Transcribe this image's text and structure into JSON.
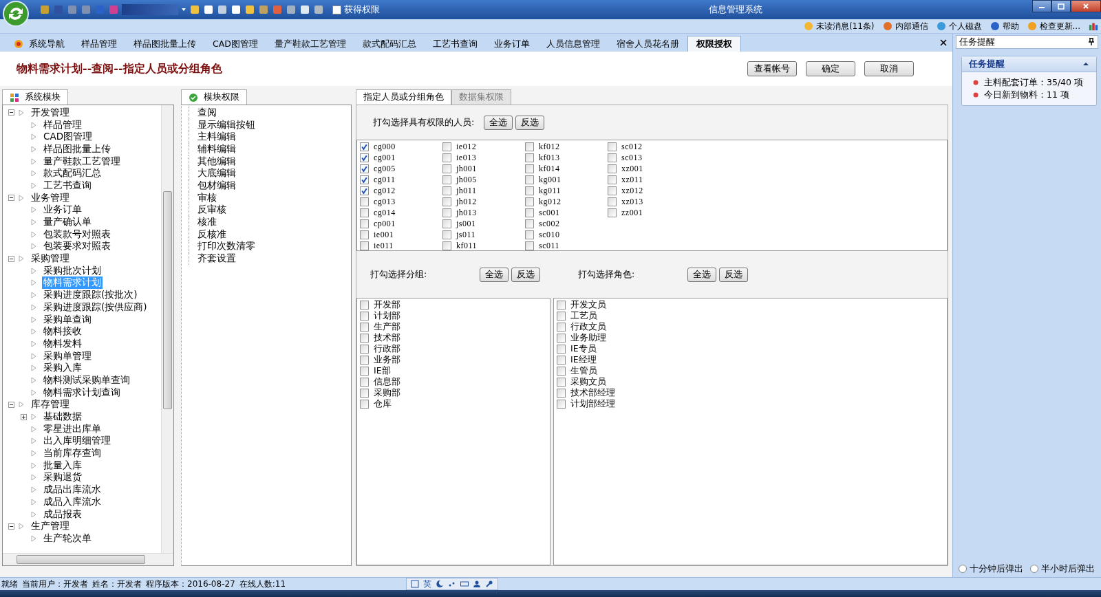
{
  "window": {
    "title": "信息管理系统"
  },
  "quick_toolbar": {
    "permission_checkbox": {
      "label": "获得权限",
      "checked": false
    }
  },
  "top_links": [
    "未读消息(11条)",
    "内部通信",
    "个人磁盘",
    "帮助",
    "检查更新..."
  ],
  "tabs": [
    {
      "label": "系统导航",
      "selected": false
    },
    {
      "label": "样品管理",
      "selected": false
    },
    {
      "label": "样品图批量上传",
      "selected": false
    },
    {
      "label": "CAD图管理",
      "selected": false
    },
    {
      "label": "量产鞋款工艺管理",
      "selected": false
    },
    {
      "label": "款式配码汇总",
      "selected": false
    },
    {
      "label": "工艺书查询",
      "selected": false
    },
    {
      "label": "业务订单",
      "selected": false
    },
    {
      "label": "人员信息管理",
      "selected": false
    },
    {
      "label": "宿舍人员花名册",
      "selected": false
    },
    {
      "label": "权限授权",
      "selected": true
    }
  ],
  "page": {
    "title": "物料需求计划--查阅--指定人员或分组角色",
    "buttons": [
      "查看帐号",
      "确定",
      "取消"
    ]
  },
  "module_panel": {
    "tab": "系统模块",
    "tree": [
      {
        "label": "开发管理",
        "expanded": true,
        "selected": false,
        "children": [
          {
            "label": "样品管理",
            "selected": false
          },
          {
            "label": "CAD图管理",
            "selected": false
          },
          {
            "label": "样品图批量上传",
            "selected": false
          },
          {
            "label": "量产鞋款工艺管理",
            "selected": false
          },
          {
            "label": "款式配码汇总",
            "selected": false
          },
          {
            "label": "工艺书查询",
            "selected": false
          }
        ]
      },
      {
        "label": "业务管理",
        "expanded": true,
        "selected": false,
        "children": [
          {
            "label": "业务订单",
            "selected": false
          },
          {
            "label": "量产确认单",
            "selected": false
          },
          {
            "label": "包装款号对照表",
            "selected": false
          },
          {
            "label": "包装要求对照表",
            "selected": false
          }
        ]
      },
      {
        "label": "采购管理",
        "expanded": true,
        "selected": false,
        "children": [
          {
            "label": "采购批次计划",
            "selected": false
          },
          {
            "label": "物料需求计划",
            "selected": true
          },
          {
            "label": "采购进度跟踪(按批次)",
            "selected": false
          },
          {
            "label": "采购进度跟踪(按供应商)",
            "selected": false
          },
          {
            "label": "采购单查询",
            "selected": false
          },
          {
            "label": "物料接收",
            "selected": false
          },
          {
            "label": "物料发料",
            "selected": false
          },
          {
            "label": "采购单管理",
            "selected": false
          },
          {
            "label": "采购入库",
            "selected": false
          },
          {
            "label": "物料测试采购单查询",
            "selected": false
          },
          {
            "label": "物料需求计划查询",
            "selected": false
          }
        ]
      },
      {
        "label": "库存管理",
        "expanded": true,
        "selected": false,
        "children": [
          {
            "label": "基础数据",
            "expanded": false,
            "selected": false
          },
          {
            "label": "零星进出库单",
            "selected": false
          },
          {
            "label": "出入库明细管理",
            "selected": false
          },
          {
            "label": "当前库存查询",
            "selected": false
          },
          {
            "label": "批量入库",
            "selected": false
          },
          {
            "label": "采购退货",
            "selected": false
          },
          {
            "label": "成品出库流水",
            "selected": false
          },
          {
            "label": "成品入库流水",
            "selected": false
          },
          {
            "label": "成品报表",
            "selected": false
          }
        ]
      },
      {
        "label": "生产管理",
        "expanded": true,
        "selected": false,
        "children": [
          {
            "label": "生产轮次单",
            "selected": false
          }
        ]
      }
    ]
  },
  "permission_panel": {
    "tab": "模块权限",
    "items": [
      "查阅",
      "显示编辑按钮",
      "主料编辑",
      "辅料编辑",
      "其他编辑",
      "大底编辑",
      "包材编辑",
      "审核",
      "反审核",
      "核准",
      "反核准",
      "打印次数清零",
      "齐套设置"
    ]
  },
  "assign_panel": {
    "tabs": [
      {
        "label": "指定人员或分组角色",
        "selected": true
      },
      {
        "label": "数据集权限",
        "selected": false
      }
    ],
    "people": {
      "prompt": "打勾选择具有权限的人员:",
      "buttons": [
        "全选",
        "反选"
      ],
      "items": [
        {
          "label": "cg000",
          "checked": true
        },
        {
          "label": "cg001",
          "checked": true
        },
        {
          "label": "cg005",
          "checked": true
        },
        {
          "label": "cg011",
          "checked": true
        },
        {
          "label": "cg012",
          "checked": true
        },
        {
          "label": "cg013",
          "checked": false
        },
        {
          "label": "cg014",
          "checked": false
        },
        {
          "label": "cp001",
          "checked": false
        },
        {
          "label": "ie001",
          "checked": false
        },
        {
          "label": "ie011",
          "checked": false
        },
        {
          "label": "ie012",
          "checked": false
        },
        {
          "label": "ie013",
          "checked": false
        },
        {
          "label": "jh001",
          "checked": false
        },
        {
          "label": "jh005",
          "checked": false
        },
        {
          "label": "jh011",
          "checked": false
        },
        {
          "label": "jh012",
          "checked": false
        },
        {
          "label": "jh013",
          "checked": false
        },
        {
          "label": "js001",
          "checked": false
        },
        {
          "label": "js011",
          "checked": false
        },
        {
          "label": "kf011",
          "checked": false
        },
        {
          "label": "kf012",
          "checked": false
        },
        {
          "label": "kf013",
          "checked": false
        },
        {
          "label": "kf014",
          "checked": false
        },
        {
          "label": "kg001",
          "checked": false
        },
        {
          "label": "kg011",
          "checked": false
        },
        {
          "label": "kg012",
          "checked": false
        },
        {
          "label": "sc001",
          "checked": false
        },
        {
          "label": "sc002",
          "checked": false
        },
        {
          "label": "sc010",
          "checked": false
        },
        {
          "label": "sc011",
          "checked": false
        },
        {
          "label": "sc012",
          "checked": false
        },
        {
          "label": "sc013",
          "checked": false
        },
        {
          "label": "xz001",
          "checked": false
        },
        {
          "label": "xz011",
          "checked": false
        },
        {
          "label": "xz012",
          "checked": false
        },
        {
          "label": "xz013",
          "checked": false
        },
        {
          "label": "zz001",
          "checked": false
        }
      ]
    },
    "groups": {
      "prompt": "打勾选择分组:",
      "buttons": [
        "全选",
        "反选"
      ],
      "items": [
        {
          "label": "开发部",
          "checked": false
        },
        {
          "label": "计划部",
          "checked": false
        },
        {
          "label": "生产部",
          "checked": false
        },
        {
          "label": "技术部",
          "checked": false
        },
        {
          "label": "行政部",
          "checked": false
        },
        {
          "label": "业务部",
          "checked": false
        },
        {
          "label": "IE部",
          "checked": false
        },
        {
          "label": "信息部",
          "checked": false
        },
        {
          "label": "采购部",
          "checked": false
        },
        {
          "label": "仓库",
          "checked": false
        }
      ]
    },
    "roles": {
      "prompt": "打勾选择角色:",
      "buttons": [
        "全选",
        "反选"
      ],
      "items": [
        {
          "label": "开发文员",
          "checked": false
        },
        {
          "label": "工艺员",
          "checked": false
        },
        {
          "label": "行政文员",
          "checked": false
        },
        {
          "label": "业务助理",
          "checked": false
        },
        {
          "label": "IE专员",
          "checked": false
        },
        {
          "label": "IE经理",
          "checked": false
        },
        {
          "label": "生管员",
          "checked": false
        },
        {
          "label": "采购文员",
          "checked": false
        },
        {
          "label": "技术部经理",
          "checked": false
        },
        {
          "label": "计划部经理",
          "checked": false
        }
      ]
    }
  },
  "task_panel": {
    "title": "任务提醒",
    "card_title": "任务提醒",
    "items": [
      "主料配套订单：35/40 项",
      "今日新到物料：11 项"
    ],
    "popup_options": [
      {
        "label": "十分钟后弹出",
        "selected": false
      },
      {
        "label": "半小时后弹出",
        "selected": false
      }
    ]
  },
  "status_bar": [
    "就绪",
    "当前用户：开发者",
    "姓名：开发者",
    "程序版本：2016-08-27",
    "在线人数:11"
  ],
  "ime_bar": {
    "label": "英"
  }
}
